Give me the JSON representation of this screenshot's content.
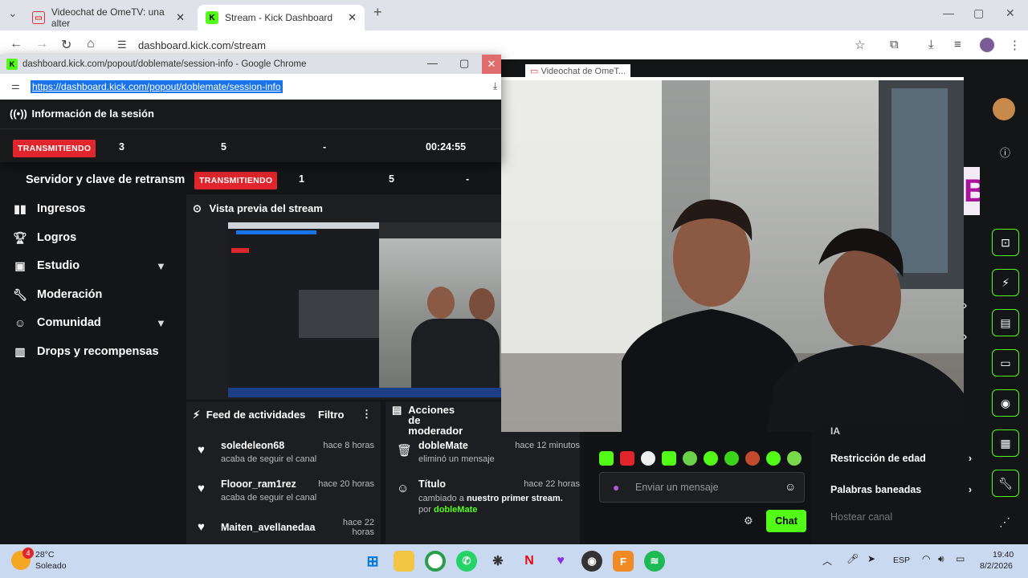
{
  "browser": {
    "tabs": [
      {
        "title": "Videochat de OmeTV: una alter",
        "favicon": "ometv-icon"
      },
      {
        "title": "Stream - Kick Dashboard",
        "favicon": "kick-icon",
        "active": true
      }
    ],
    "new_tab": "+",
    "address": "dashboard.kick.com/stream"
  },
  "popup": {
    "window_title": "dashboard.kick.com/popout/doblemate/session-info - Google Chrome",
    "url": "https://dashboard.kick.com/popout/doblemate/session-info",
    "header": "Información de la sesión",
    "status": "TRANSMITIENDO",
    "stats": [
      "3",
      "5",
      "-",
      "00:24:55"
    ]
  },
  "ome_window": {
    "title": "Videochat de OmeT..."
  },
  "sidebar": {
    "partial_item": "Servidor y clave de retransm",
    "items": [
      {
        "label": "Ingresos",
        "icon": "bar-chart-icon"
      },
      {
        "label": "Logros",
        "icon": "trophy-icon"
      },
      {
        "label": "Estudio",
        "icon": "studio-icon",
        "expand": true
      },
      {
        "label": "Moderación",
        "icon": "wrench-icon"
      },
      {
        "label": "Comunidad",
        "icon": "users-icon",
        "expand": true
      },
      {
        "label": "Drops y recompensas",
        "icon": "gift-icon"
      }
    ]
  },
  "session_bar": {
    "status": "TRANSMITIENDO",
    "stats": [
      "1",
      "5",
      "-"
    ]
  },
  "preview": {
    "title": "Vista previa del stream"
  },
  "feed": {
    "title": "Feed de actividades",
    "filter": "Filtro",
    "rows": [
      {
        "name": "soledeleon68",
        "time": "hace 8 horas",
        "desc": "acaba de seguir el canal"
      },
      {
        "name": "Flooor_ram1rez",
        "time": "hace 20 horas",
        "desc": "acaba de seguir el canal"
      },
      {
        "name": "Maiten_avellanedaa",
        "time": "hace 22 horas",
        "desc": ""
      }
    ]
  },
  "mod_actions": {
    "title": "Acciones de moderador",
    "rows": [
      {
        "name": "dobleMate",
        "time": "hace 12 minutos",
        "desc": "eliminó un mensaje"
      },
      {
        "name": "Título",
        "time": "hace 22 horas",
        "desc_pre": "cambiado a ",
        "desc_bold": "nuestro primer stream.",
        "by_pre": "por ",
        "by": "dobleMate"
      }
    ]
  },
  "chat": {
    "placeholder": "Enviar un mensaje",
    "send": "Chat"
  },
  "settings_panel": {
    "partial": "IA",
    "items": [
      "Restricción de edad",
      "Palabras baneadas"
    ],
    "disabled": "Hostear canal"
  },
  "banner_text": "BLE",
  "taskbar": {
    "temp": "28°C",
    "weather": "Soleado",
    "weather_badge": "4",
    "lang": "ESP",
    "time": "19:40",
    "date": "8/2/2026"
  }
}
